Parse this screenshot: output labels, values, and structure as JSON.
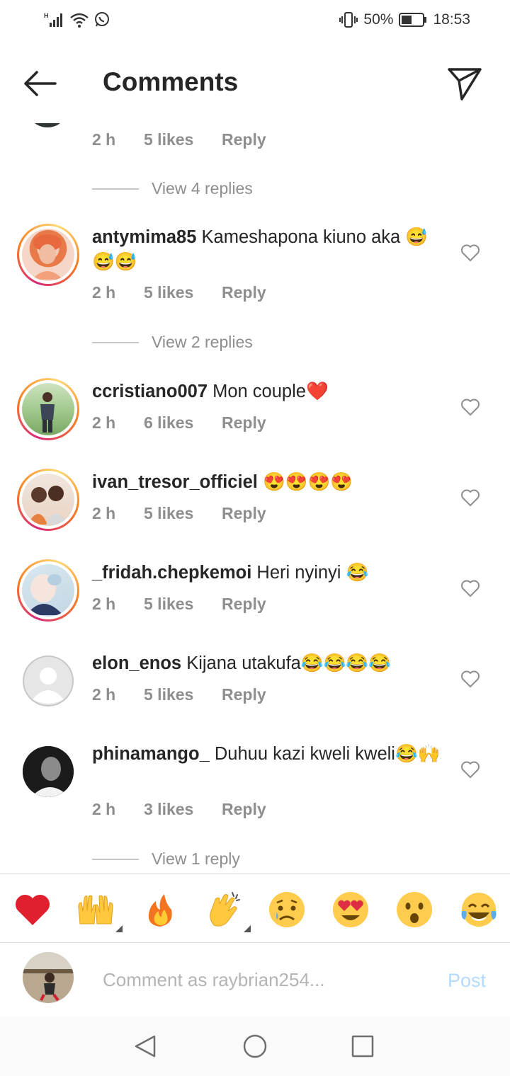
{
  "status_bar": {
    "network_label": "H",
    "battery_percent": "50%",
    "battery_level": 0.5,
    "time": "18:53"
  },
  "header": {
    "title": "Comments"
  },
  "comments": [
    {
      "partial": true,
      "time": "2 h",
      "likes": "5 likes",
      "reply_label": "Reply",
      "view_replies": "View 4 replies"
    },
    {
      "username": "antymima85",
      "text": "Kameshapona kiuno aka 😅😅😅",
      "time": "2 h",
      "likes": "5 likes",
      "reply_label": "Reply",
      "view_replies": "View 2 replies",
      "avatar_icon": "woman-portrait"
    },
    {
      "username": "ccristiano007",
      "text": "Mon couple❤️",
      "time": "2 h",
      "likes": "6 likes",
      "reply_label": "Reply",
      "avatar_icon": "man-outdoor-portrait"
    },
    {
      "username": "ivan_tresor_officiel",
      "text": "😍😍😍😍",
      "time": "2 h",
      "likes": "5 likes",
      "reply_label": "Reply",
      "avatar_icon": "two-people-portrait"
    },
    {
      "username": "_fridah.chepkemoi",
      "text": "Heri nyinyi 😂",
      "time": "2 h",
      "likes": "5 likes",
      "reply_label": "Reply",
      "avatar_icon": "woman-selfie"
    },
    {
      "username": "elon_enos",
      "text": "Kijana utakufa😂😂😂😂",
      "time": "2 h",
      "likes": "5 likes",
      "reply_label": "Reply",
      "avatar_icon": "default-avatar"
    },
    {
      "username": "phinamango_",
      "text": "Duhuu kazi kweli kweli😂🙌",
      "time": "2 h",
      "likes": "3 likes",
      "reply_label": "Reply",
      "view_replies": "View 1 reply",
      "avatar_icon": "man-dark-portrait"
    }
  ],
  "reactions": [
    {
      "emoji": "❤️",
      "name": "red-heart"
    },
    {
      "emoji": "🙌",
      "name": "raising-hands",
      "has_variants": true
    },
    {
      "emoji": "🔥",
      "name": "fire"
    },
    {
      "emoji": "👏",
      "name": "clapping-hands",
      "has_variants": true
    },
    {
      "emoji": "😢",
      "name": "crying-face"
    },
    {
      "emoji": "😍",
      "name": "heart-eyes"
    },
    {
      "emoji": "😮",
      "name": "open-mouth"
    },
    {
      "emoji": "😂",
      "name": "tears-of-joy"
    }
  ],
  "composer": {
    "placeholder": "Comment as raybrian254...",
    "post_label": "Post",
    "post_color": "#b3dbff"
  },
  "colors": {
    "text_primary": "#262626",
    "text_secondary": "#8e8e8e",
    "story_ring_start": "#d62976",
    "story_ring_end": "#feda75"
  }
}
